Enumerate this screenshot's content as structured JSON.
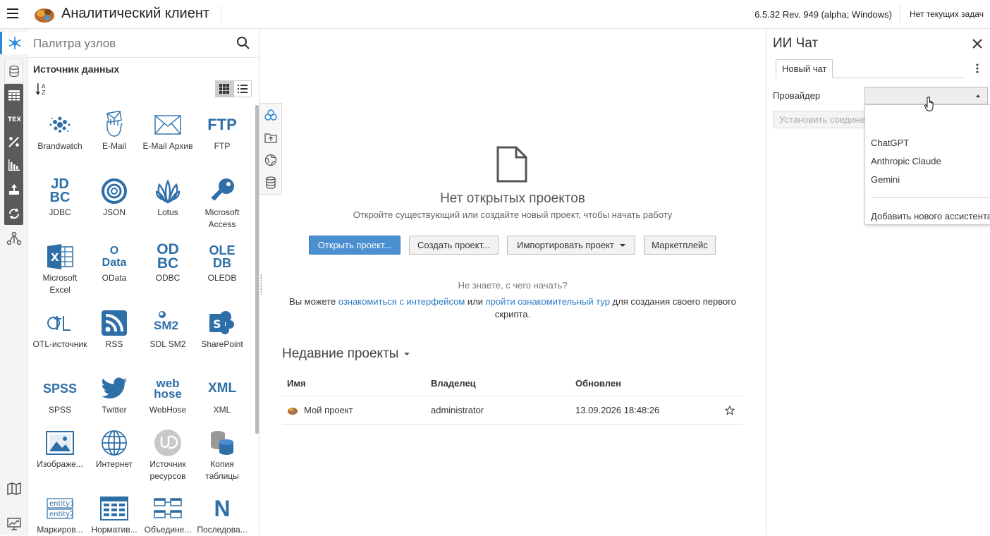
{
  "header": {
    "app_title": "Аналитический клиент",
    "version": "6.5.32 Rev. 949 (alpha; Windows)",
    "tasks": "Нет текущих задач"
  },
  "left_nav": {
    "items": [
      "snowflake-icon",
      "database-icon",
      "table-icon",
      "text-icon",
      "percent-icon",
      "bar-chart-icon",
      "export-icon",
      "recycle-icon",
      "network-icon",
      "map-icon",
      "monitor-chart-icon"
    ],
    "active_color": "#2a8ad8"
  },
  "palette": {
    "search_placeholder": "Палитра узлов",
    "section_title": "Источник данных",
    "nodes": [
      {
        "label": "Brandwatch",
        "icon": "brandwatch-icon"
      },
      {
        "label": "E-Mail",
        "icon": "email-hand-icon"
      },
      {
        "label": "E-Mail Архив",
        "icon": "email-archive-icon"
      },
      {
        "label": "FTP",
        "icon": "ftp-icon"
      },
      {
        "label": "JDBC",
        "icon": "jdbc-icon"
      },
      {
        "label": "JSON",
        "icon": "json-icon"
      },
      {
        "label": "Lotus",
        "icon": "lotus-icon"
      },
      {
        "label": "Microsoft Access",
        "icon": "access-key-icon"
      },
      {
        "label": "Microsoft Excel",
        "icon": "excel-icon"
      },
      {
        "label": "OData",
        "icon": "odata-icon"
      },
      {
        "label": "ODBC",
        "icon": "odbc-icon"
      },
      {
        "label": "OLEDB",
        "icon": "oledb-icon"
      },
      {
        "label": "OTL-источник",
        "icon": "otl-icon"
      },
      {
        "label": "RSS",
        "icon": "rss-icon"
      },
      {
        "label": "SDL SM2",
        "icon": "sdl-sm2-icon"
      },
      {
        "label": "SharePoint",
        "icon": "sharepoint-icon"
      },
      {
        "label": "SPSS",
        "icon": "spss-icon"
      },
      {
        "label": "Twitter",
        "icon": "twitter-icon"
      },
      {
        "label": "WebHose",
        "icon": "webhose-icon"
      },
      {
        "label": "XML",
        "icon": "xml-icon"
      },
      {
        "label": "Изображе...",
        "icon": "image-icon"
      },
      {
        "label": "Интернет",
        "icon": "globe-icon"
      },
      {
        "label": "Источник ресурсов",
        "icon": "resource-source-icon"
      },
      {
        "label": "Копия таблицы",
        "icon": "table-copy-icon"
      },
      {
        "label": "Маркиров...",
        "icon": "entity-icon"
      },
      {
        "label": "Норматив...",
        "icon": "normative-icon"
      },
      {
        "label": "Объедине...",
        "icon": "merge-icon"
      },
      {
        "label": "Последова...",
        "icon": "sequence-icon"
      }
    ],
    "icon_texts": {
      "ftp": "FTP",
      "jdbc_top": "JD",
      "jdbc_bottom": "BC",
      "odata_top": "O",
      "odata_bottom": "Data",
      "odbc_top": "OD",
      "odbc_bottom": "BC",
      "oledb_top": "OLE",
      "oledb_bottom": "DB",
      "sdl": "SM2",
      "spss": "SPSS",
      "webhose_top": "web",
      "webhose_bottom": "hose",
      "xml": "XML",
      "entity1": "entity1",
      "entity2": "entity2",
      "sequence": "N",
      "excel": "X",
      "sharepoint": "S"
    },
    "icon_color": "#2e6fa8"
  },
  "main": {
    "empty_title": "Нет открытых проектов",
    "empty_subtitle": "Откройте существующий или создайте новый проект, чтобы начать работу",
    "buttons": {
      "open": "Открыть проект...",
      "create": "Создать проект...",
      "import": "Импортировать проект",
      "marketplace": "Маркетплейс"
    },
    "help_question": "Не знаете, с чего начать?",
    "help_prefix": "Вы можете",
    "help_link1": "ознакомиться с интерфейсом",
    "help_or": "или",
    "help_link2": "пройти ознакомительный тур",
    "help_suffix": "для создания своего первого скрипта.",
    "recent_title": "Недавние проекты",
    "table": {
      "columns": [
        "Имя",
        "Владелец",
        "Обновлен"
      ],
      "rows": [
        {
          "name": "Мой проект",
          "owner": "administrator",
          "updated": "13.09.2026 18:48:26"
        }
      ]
    }
  },
  "chat": {
    "title": "ИИ Чат",
    "tab": "Новый чат",
    "provider_label": "Провайдер",
    "provider_value": "",
    "connect_button": "Установить соединение",
    "dropdown_options": [
      "ChatGPT",
      "Anthropic Claude",
      "Gemini"
    ],
    "dropdown_add": "Добавить нового ассистента"
  }
}
